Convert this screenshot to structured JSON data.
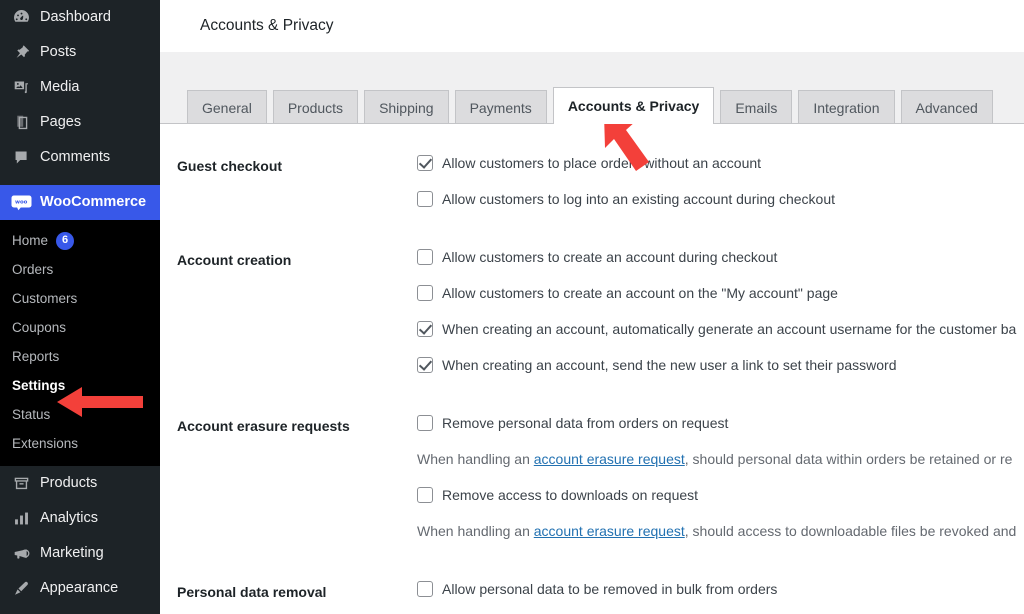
{
  "sidebar": {
    "items": [
      {
        "label": "Dashboard",
        "icon": "dashboard-icon"
      },
      {
        "label": "Posts",
        "icon": "pin-icon"
      },
      {
        "label": "Media",
        "icon": "media-icon"
      },
      {
        "label": "Pages",
        "icon": "pages-icon"
      },
      {
        "label": "Comments",
        "icon": "comments-icon"
      },
      {
        "label": "WooCommerce",
        "icon": "woocommerce-icon"
      }
    ],
    "submenu": [
      {
        "label": "Home",
        "badge": "6"
      },
      {
        "label": "Orders",
        "badge": ""
      },
      {
        "label": "Customers",
        "badge": ""
      },
      {
        "label": "Coupons",
        "badge": ""
      },
      {
        "label": "Reports",
        "badge": ""
      },
      {
        "label": "Settings",
        "badge": ""
      },
      {
        "label": "Status",
        "badge": ""
      },
      {
        "label": "Extensions",
        "badge": ""
      }
    ],
    "bottom_items": [
      {
        "label": "Products",
        "icon": "products-icon"
      },
      {
        "label": "Analytics",
        "icon": "analytics-icon"
      },
      {
        "label": "Marketing",
        "icon": "megaphone-icon"
      },
      {
        "label": "Appearance",
        "icon": "brush-icon"
      }
    ],
    "current_item": "WooCommerce",
    "current_subitem": "Settings",
    "accent_color": "#3858e9",
    "background_color": "#1d2327",
    "submenu_background_color": "#000000"
  },
  "header": {
    "title": "Accounts & Privacy"
  },
  "tabs": [
    {
      "label": "General",
      "active": false
    },
    {
      "label": "Products",
      "active": false
    },
    {
      "label": "Shipping",
      "active": false
    },
    {
      "label": "Payments",
      "active": false
    },
    {
      "label": "Accounts & Privacy",
      "active": true
    },
    {
      "label": "Emails",
      "active": false
    },
    {
      "label": "Integration",
      "active": false
    },
    {
      "label": "Advanced",
      "active": false
    }
  ],
  "sections": [
    {
      "label": "Guest checkout",
      "fields": [
        {
          "kind": "checkbox",
          "checked": true,
          "text": "Allow customers to place orders without an account"
        },
        {
          "kind": "checkbox",
          "checked": false,
          "text": "Allow customers to log into an existing account during checkout"
        }
      ]
    },
    {
      "label": "Account creation",
      "fields": [
        {
          "kind": "checkbox",
          "checked": false,
          "text": "Allow customers to create an account during checkout"
        },
        {
          "kind": "checkbox",
          "checked": false,
          "text": "Allow customers to create an account on the \"My account\" page"
        },
        {
          "kind": "checkbox",
          "checked": true,
          "text": "When creating an account, automatically generate an account username for the customer ba"
        },
        {
          "kind": "checkbox",
          "checked": true,
          "text": "When creating an account, send the new user a link to set their password"
        }
      ]
    },
    {
      "label": "Account erasure requests",
      "fields": [
        {
          "kind": "checkbox",
          "checked": false,
          "text": "Remove personal data from orders on request"
        },
        {
          "kind": "description",
          "before": "When handling an ",
          "link": "account erasure request",
          "after": ", should personal data within orders be retained or re"
        },
        {
          "kind": "checkbox",
          "checked": false,
          "text": "Remove access to downloads on request"
        },
        {
          "kind": "description",
          "before": "When handling an ",
          "link": "account erasure request",
          "after": ", should access to downloadable files be revoked and"
        }
      ]
    },
    {
      "label": "Personal data removal",
      "fields": [
        {
          "kind": "checkbox",
          "checked": false,
          "text": "Allow personal data to be removed in bulk from orders"
        }
      ]
    }
  ],
  "annotations": {
    "arrow_color": "#f3403a",
    "arrows": [
      {
        "name": "arrow-pointing-to-accounts-privacy-tab"
      },
      {
        "name": "arrow-pointing-to-settings-menu-item"
      }
    ]
  }
}
